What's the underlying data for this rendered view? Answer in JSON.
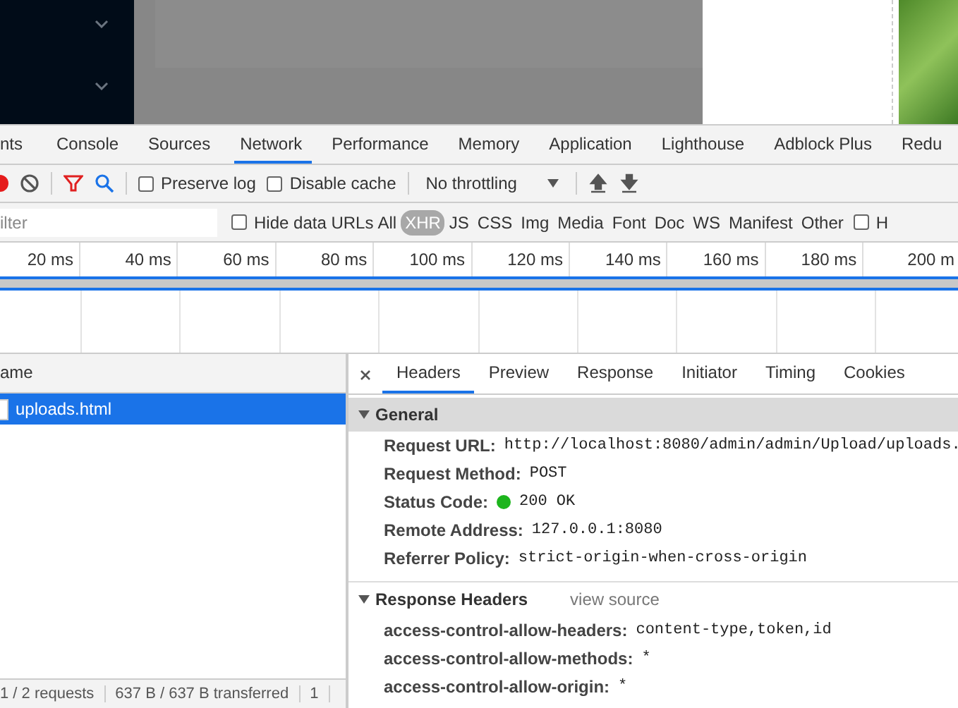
{
  "devtools_tabs": [
    {
      "label": "nts",
      "selected": false
    },
    {
      "label": "Console",
      "selected": false
    },
    {
      "label": "Sources",
      "selected": false
    },
    {
      "label": "Network",
      "selected": true
    },
    {
      "label": "Performance",
      "selected": false
    },
    {
      "label": "Memory",
      "selected": false
    },
    {
      "label": "Application",
      "selected": false
    },
    {
      "label": "Lighthouse",
      "selected": false
    },
    {
      "label": "Adblock Plus",
      "selected": false
    },
    {
      "label": "Redu",
      "selected": false
    }
  ],
  "toolbar": {
    "recording": true,
    "preserve_log": {
      "label": "Preserve log",
      "checked": false
    },
    "disable_cache": {
      "label": "Disable cache",
      "checked": false
    },
    "throttling": "No throttling"
  },
  "filter_bar": {
    "placeholder": "ilter",
    "hide_data_urls": {
      "label": "Hide data URLs",
      "checked": false
    },
    "types": [
      {
        "label": "All",
        "selected": false
      },
      {
        "label": "XHR",
        "selected": true
      },
      {
        "label": "JS",
        "selected": false
      },
      {
        "label": "CSS",
        "selected": false
      },
      {
        "label": "Img",
        "selected": false
      },
      {
        "label": "Media",
        "selected": false
      },
      {
        "label": "Font",
        "selected": false
      },
      {
        "label": "Doc",
        "selected": false
      },
      {
        "label": "WS",
        "selected": false
      },
      {
        "label": "Manifest",
        "selected": false
      },
      {
        "label": "Other",
        "selected": false
      }
    ],
    "last_checkbox": {
      "label": "H",
      "checked": false
    }
  },
  "timeline": {
    "ticks": [
      "20 ms",
      "40 ms",
      "60 ms",
      "80 ms",
      "100 ms",
      "120 ms",
      "140 ms",
      "160 ms",
      "180 ms",
      "200 m"
    ]
  },
  "request_list": {
    "column": "ame",
    "rows": [
      {
        "name": "uploads.html",
        "selected": true
      }
    ]
  },
  "details": {
    "tabs": [
      {
        "label": "Headers",
        "selected": true
      },
      {
        "label": "Preview",
        "selected": false
      },
      {
        "label": "Response",
        "selected": false
      },
      {
        "label": "Initiator",
        "selected": false
      },
      {
        "label": "Timing",
        "selected": false
      },
      {
        "label": "Cookies",
        "selected": false
      }
    ],
    "general": {
      "title": "General",
      "expanded": true,
      "rows": [
        {
          "label": "Request URL:",
          "value": "http://localhost:8080/admin/admin/Upload/uploads."
        },
        {
          "label": "Request Method:",
          "value": "POST"
        },
        {
          "label": "Status Code:",
          "value": "200 OK",
          "color": "#1db51d"
        },
        {
          "label": "Remote Address:",
          "value": "127.0.0.1:8080"
        },
        {
          "label": "Referrer Policy:",
          "value": "strict-origin-when-cross-origin"
        }
      ]
    },
    "response_headers": {
      "title": "Response Headers",
      "expanded": true,
      "link": "view source",
      "rows": [
        {
          "label": "access-control-allow-headers:",
          "value": "content-type,token,id"
        },
        {
          "label": "access-control-allow-methods:",
          "value": "*"
        },
        {
          "label": "access-control-allow-origin:",
          "value": "*"
        }
      ]
    }
  },
  "status_bar": [
    "1 / 2 requests",
    "637 B / 637 B transferred",
    "1"
  ]
}
